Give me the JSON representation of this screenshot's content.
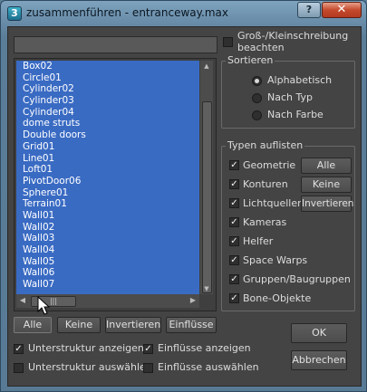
{
  "window": {
    "title": "zusammenführen - entranceway.max",
    "app_icon_glyph": "3",
    "help_label": "?",
    "close_label": "✕"
  },
  "search": {
    "value": ""
  },
  "objects": [
    "Box02",
    "Circle01",
    "Cylinder02",
    "Cylinder03",
    "Cylinder04",
    "dome struts",
    "Double doors",
    "Grid01",
    "Line01",
    "Loft01",
    "PivotDoor06",
    "Sphere01",
    "Terrain01",
    "Wall01",
    "Wall02",
    "Wall03",
    "Wall04",
    "Wall05",
    "Wall06",
    "Wall07"
  ],
  "case_sensitive": {
    "label": "Groß-/Kleinschreibung beachten",
    "checked": false
  },
  "sort": {
    "title": "Sortieren",
    "options": [
      {
        "label": "Alphabetisch",
        "selected": true
      },
      {
        "label": "Nach Typ",
        "selected": false
      },
      {
        "label": "Nach Farbe",
        "selected": false
      }
    ]
  },
  "list_types": {
    "title": "Typen auflisten",
    "items": [
      {
        "label": "Geometrie",
        "checked": true
      },
      {
        "label": "Konturen",
        "checked": true
      },
      {
        "label": "Lichtquellen",
        "checked": true
      },
      {
        "label": "Kameras",
        "checked": true
      },
      {
        "label": "Helfer",
        "checked": true
      },
      {
        "label": "Space Warps",
        "checked": true
      },
      {
        "label": "Gruppen/Baugruppen",
        "checked": true
      },
      {
        "label": "Bone-Objekte",
        "checked": true
      }
    ],
    "buttons": {
      "all": "Alle",
      "none": "Keine",
      "invert": "Invertieren"
    }
  },
  "bottom_buttons": {
    "all": "Alle",
    "none": "Keine",
    "invert": "Invertieren",
    "influences": "Einflüsse"
  },
  "options": {
    "show_substructure": {
      "label": "Unterstruktur anzeigen",
      "checked": true
    },
    "show_influences": {
      "label": "Einflüsse anzeigen",
      "checked": true
    },
    "select_substructure": {
      "label": "Unterstruktur auswählen",
      "checked": false
    },
    "select_influences": {
      "label": "Einflüsse auswählen",
      "checked": false
    }
  },
  "dialog_buttons": {
    "ok": "OK",
    "cancel": "Abbrechen"
  },
  "scrollbar": {
    "h_thumb_glyph": "|||"
  },
  "colors": {
    "selection": "#3a6bc3",
    "panel": "#444444"
  }
}
